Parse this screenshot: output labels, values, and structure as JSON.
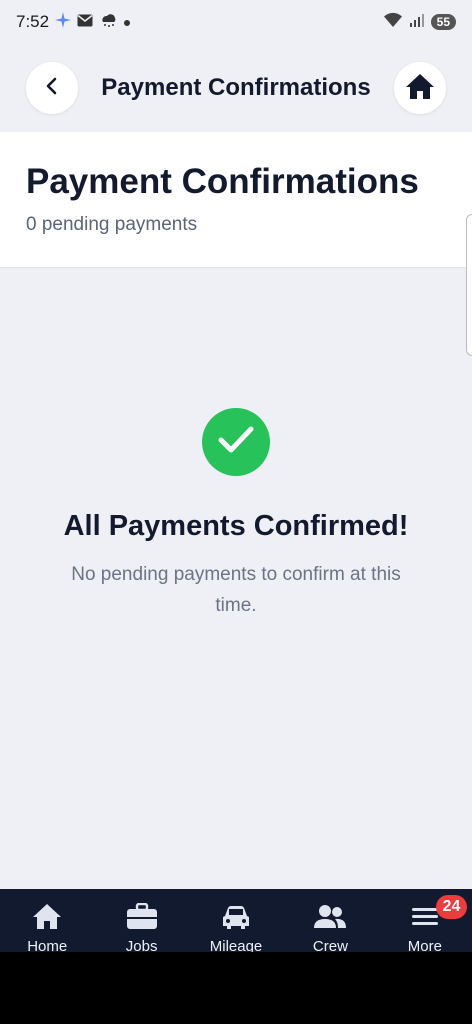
{
  "status_bar": {
    "time": "7:52",
    "battery": "55",
    "icons": [
      "gemini-icon",
      "mail-icon",
      "weather-icon",
      "dot-icon",
      "wifi-icon",
      "signal-icon"
    ]
  },
  "header": {
    "title": "Payment Confirmations",
    "back_icon": "back-arrow-icon",
    "home_icon": "home-icon"
  },
  "summary": {
    "title": "Payment Confirmations",
    "subtitle": "0 pending payments"
  },
  "empty_state": {
    "icon": "check-icon",
    "title": "All Payments Confirmed!",
    "message": "No pending payments to confirm at this time."
  },
  "nav": {
    "items": [
      {
        "label": "Home",
        "icon": "home-icon"
      },
      {
        "label": "Jobs",
        "icon": "briefcase-icon"
      },
      {
        "label": "Mileage",
        "icon": "car-icon"
      },
      {
        "label": "Crew",
        "icon": "people-icon"
      },
      {
        "label": "More",
        "icon": "menu-icon",
        "badge": "24"
      }
    ]
  },
  "colors": {
    "accent_success": "#27c25a",
    "nav_bg": "#111a2e",
    "badge": "#ef3b3b",
    "page_bg": "#eff0f5"
  }
}
